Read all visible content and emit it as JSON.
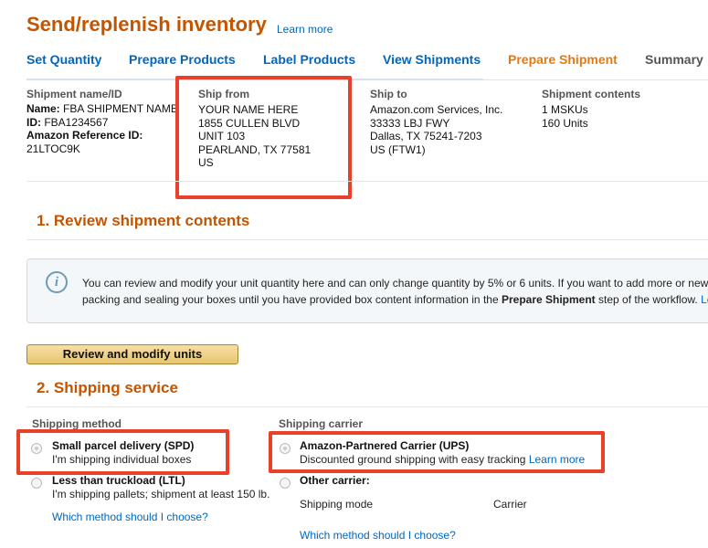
{
  "header": {
    "title": "Send/replenish inventory",
    "learn_more": "Learn more"
  },
  "tabs": [
    {
      "label": "Set Quantity"
    },
    {
      "label": "Prepare Products"
    },
    {
      "label": "Label Products"
    },
    {
      "label": "View Shipments"
    },
    {
      "label": "Prepare Shipment"
    },
    {
      "label": "Summary"
    }
  ],
  "shipment": {
    "name_col": {
      "heading": "Shipment name/ID",
      "name_label": "Name:",
      "name_value": "FBA SHIPMENT NAME",
      "id_label": "ID:",
      "id_value": "FBA1234567",
      "ref_label": "Amazon Reference ID:",
      "ref_value": "21LTOC9K"
    },
    "ship_from": {
      "heading": "Ship from",
      "lines": [
        "YOUR NAME HERE",
        "1855 CULLEN BLVD",
        "UNIT 103",
        "PEARLAND, TX 77581",
        "US"
      ]
    },
    "ship_to": {
      "heading": "Ship to",
      "lines": [
        "Amazon.com Services, Inc.",
        "33333 LBJ FWY",
        "Dallas, TX 75241-7203",
        "US (FTW1)"
      ]
    },
    "contents": {
      "heading": "Shipment contents",
      "lines": [
        "1 MSKUs",
        "160 Units"
      ]
    }
  },
  "review": {
    "heading": "1. Review shipment contents",
    "info_line1": "You can review and modify your unit quantity here and can only change quantity by 5% or 6 units. If you want to add more or new",
    "info_line2_pre": "packing and sealing your boxes until you have provided box content information in the ",
    "info_line2_bold": "Prepare Shipment",
    "info_line2_post": " step of the workflow.",
    "info_line2_link": "Le",
    "button": "Review and modify units"
  },
  "shipping": {
    "heading": "2. Shipping service",
    "method_heading": "Shipping method",
    "methods": [
      {
        "title": "Small parcel delivery (SPD)",
        "desc": "I'm shipping individual boxes"
      },
      {
        "title": "Less than truckload (LTL)",
        "desc": "I'm shipping pallets; shipment at least 150 lb."
      }
    ],
    "method_help": "Which method should I choose?",
    "carrier_heading": "Shipping carrier",
    "carrier_partnered_title": "Amazon-Partnered Carrier (UPS)",
    "carrier_partnered_desc": "Discounted ground shipping with easy tracking",
    "carrier_learn_more": "Learn more",
    "carrier_other_title": "Other carrier:",
    "shipping_mode_label": "Shipping mode",
    "carrier_label": "Carrier",
    "carrier_help": "Which method should I choose?"
  },
  "colors": {
    "brand_orange": "#c45500",
    "link_blue": "#0066c0",
    "active_tab": "#e47911",
    "highlight_red": "#e8402a"
  }
}
